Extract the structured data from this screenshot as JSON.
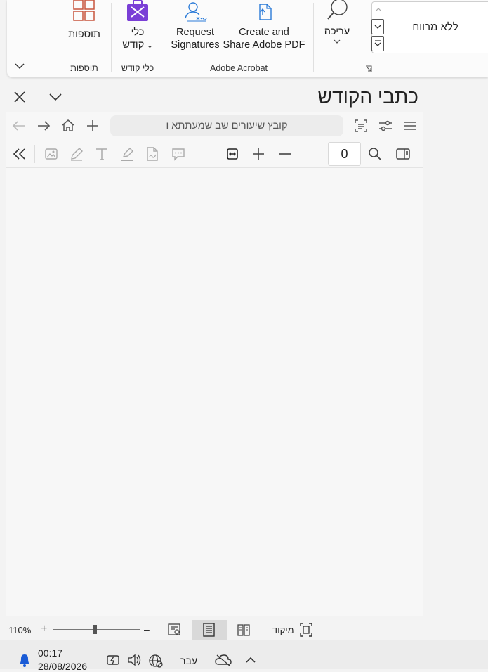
{
  "ribbon": {
    "styles_gallery": {
      "item": "ללא מרווח"
    },
    "edit": {
      "label": "עריכה"
    },
    "acrobat": {
      "create_share_line1": "Create and",
      "create_share_line2": "Share Adobe PDF",
      "request_sig_line1": "Request",
      "request_sig_line2": "Signatures",
      "group_label": "Adobe Acrobat"
    },
    "kodesh_tools": {
      "line1": "כלי",
      "line2": "קודש",
      "group_label": "כלי קודש"
    },
    "addins": {
      "label": "תוספות",
      "group_label": "תוספות"
    }
  },
  "pane": {
    "title": "כתבי הקודש"
  },
  "browser": {
    "url_text": "קובץ שיעורים שב שמעתתא ו"
  },
  "pdf": {
    "page_number": "0"
  },
  "status_bar": {
    "zoom": "110%",
    "zoom_plus": "+",
    "zoom_minus": "–",
    "focus_label": "מיקוד",
    "zoom_fraction": 0.48
  },
  "taskbar": {
    "time": "00:17",
    "date": "28/08/2026",
    "language": "עבר"
  },
  "colors": {
    "accent_orange": "#c8553d",
    "accent_purple": "#7a3fd6",
    "accent_blue": "#2b7bd8"
  }
}
